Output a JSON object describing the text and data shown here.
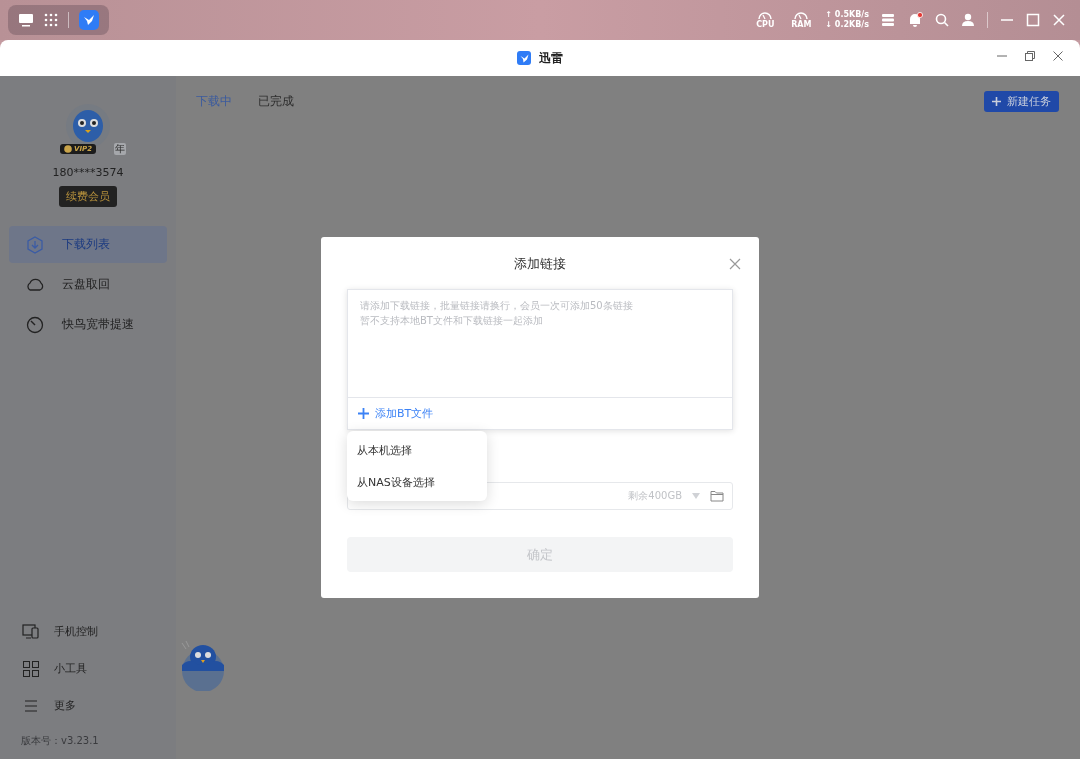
{
  "taskbar": {
    "gauges": [
      {
        "label": "CPU"
      },
      {
        "label": "RAM"
      }
    ],
    "speeds": [
      {
        "arrow": "↑",
        "value": "0.5KB/s"
      },
      {
        "arrow": "↓",
        "value": "0.2KB/s"
      }
    ],
    "has_notification": true
  },
  "window": {
    "title": "迅雷"
  },
  "sidebar": {
    "user": {
      "vip_label": "VIP2",
      "vip_suffix": "年",
      "phone": "180****3574"
    },
    "renew_button": "续费会员",
    "items": [
      {
        "label": "下载列表",
        "selected": true
      },
      {
        "label": "云盘取回",
        "selected": false
      },
      {
        "label": "快鸟宽带提速",
        "selected": false
      }
    ],
    "bottom_items": [
      {
        "label": "手机控制"
      },
      {
        "label": "小工具"
      },
      {
        "label": "更多"
      }
    ],
    "version": "版本号：v3.23.1"
  },
  "tabs": [
    {
      "label": "下载中",
      "selected": true
    },
    {
      "label": "已完成",
      "selected": false
    }
  ],
  "new_task_button": "新建任务",
  "dialog": {
    "title": "添加链接",
    "placeholder": [
      "请添加下载链接，批量链接请换行，会员一次可添加50条链接",
      "暂不支持本地BT文件和下载链接一起添加"
    ],
    "add_bt": "添加BT文件",
    "menu": [
      {
        "label": "从本机选择"
      },
      {
        "label": "从NAS设备选择"
      }
    ],
    "path_field": {
      "free_space": "剩余400GB"
    },
    "confirm": {
      "label": "确定",
      "disabled": true
    }
  }
}
